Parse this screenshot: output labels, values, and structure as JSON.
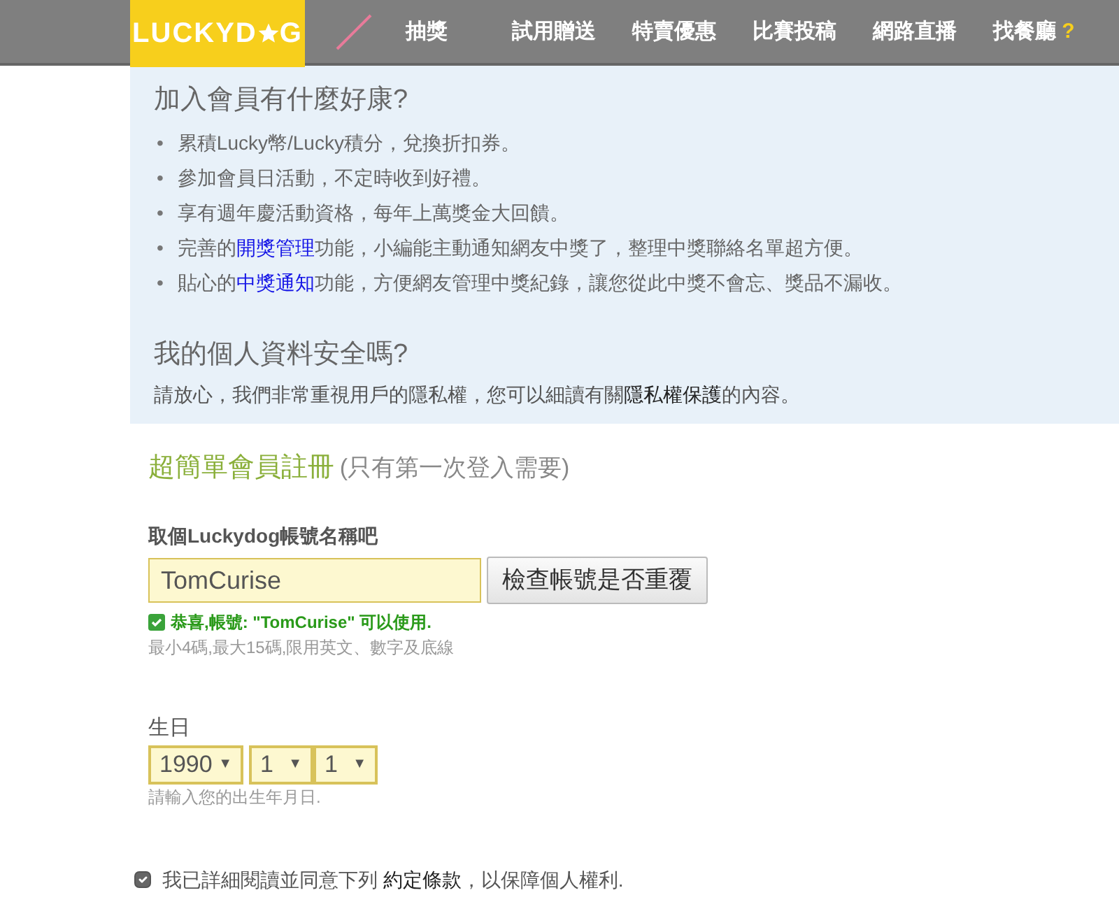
{
  "header": {
    "logo": {
      "before": "LUCKYD",
      "after": "G"
    },
    "nav": [
      {
        "label": "抽獎"
      },
      {
        "label": "試用贈送"
      },
      {
        "label": "特賣優惠"
      },
      {
        "label": "比賽投稿"
      },
      {
        "label": "網路直播"
      },
      {
        "label": "找餐廳",
        "mark": "?"
      }
    ]
  },
  "benefits": {
    "title": "加入會員有什麼好康?",
    "items": [
      {
        "marker": "•",
        "before": "累積Lucky幣/Lucky積分，兌換折扣券。"
      },
      {
        "marker": "•",
        "before": "參加會員日活動，不定時收到好禮。"
      },
      {
        "marker": "•",
        "before": "享有週年慶活動資格，每年上萬獎金大回饋。"
      },
      {
        "marker": "•",
        "before": "完善的",
        "link": "開獎管理",
        "after": "功能，小編能主動通知網友中獎了，整理中獎聯絡名單超方便。"
      },
      {
        "marker": "•",
        "before": "貼心的",
        "link": "中獎通知",
        "after": "功能，方便網友管理中獎紀錄，讓您從此中獎不會忘、獎品不漏收。"
      }
    ]
  },
  "privacy": {
    "title": "我的個人資料安全嗎?",
    "before": "請放心，我們非常重視用戶的隱私權，您可以細讀有關",
    "link": "隱私權保護",
    "after": "的內容。"
  },
  "signup": {
    "title": "超簡單會員註冊",
    "subtitle": "(只有第一次登入需要)",
    "account": {
      "label": "取個Luckydog帳號名稱吧",
      "value": "TomCurise",
      "button": "檢查帳號是否重覆",
      "valid": true,
      "message": "恭喜,帳號: \"TomCurise\" 可以使用.",
      "hint": "最小4碼,最大15碼,限用英文、數字及底線"
    },
    "birthday": {
      "label": "生日",
      "selects": [
        {
          "value": "1990",
          "caret": "▼"
        },
        {
          "value": "1",
          "caret": "▼"
        },
        {
          "value": "1",
          "caret": "▼"
        }
      ],
      "hint": "請輸入您的出生年月日."
    },
    "agree": {
      "checked": true,
      "before": "我已詳細閱讀並同意下列",
      "link": "約定條款",
      "after": "，以保障個人權利."
    }
  }
}
